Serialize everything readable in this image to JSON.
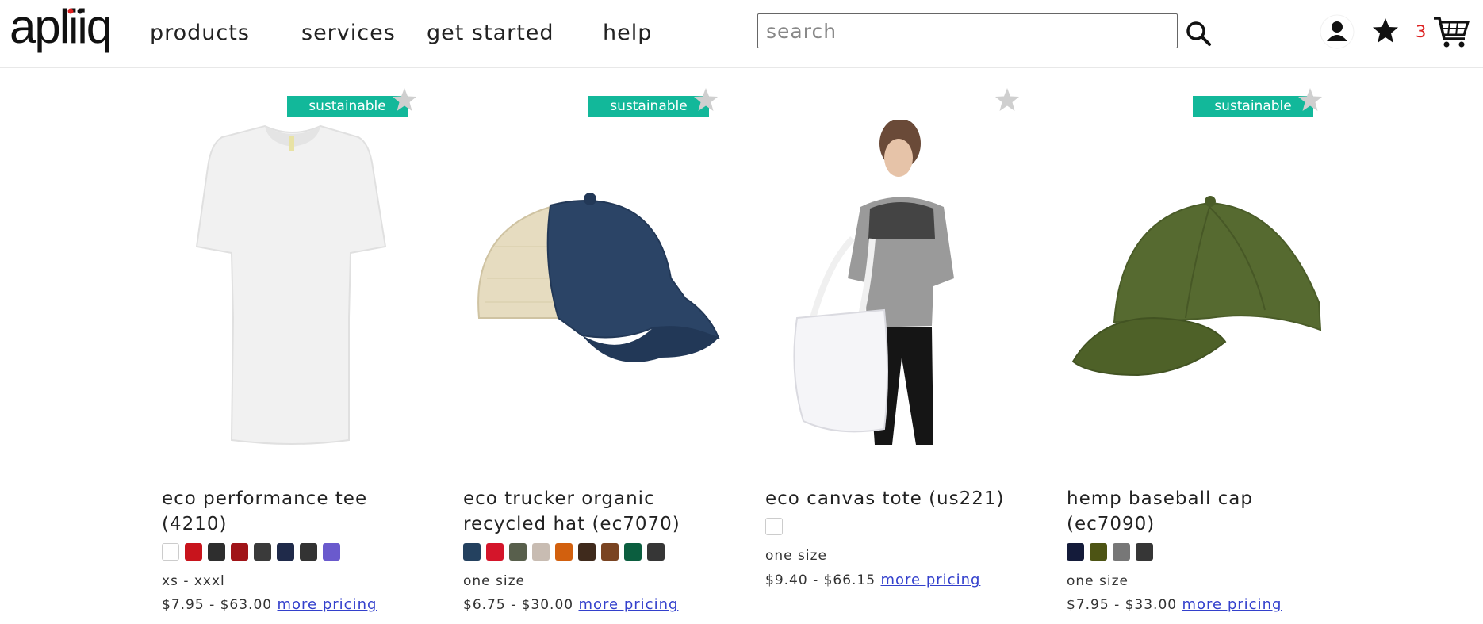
{
  "header": {
    "logo_text": "apliiq",
    "nav": [
      {
        "label": "products"
      },
      {
        "label": "services"
      },
      {
        "label": "get started"
      },
      {
        "label": "help"
      }
    ],
    "search": {
      "placeholder": "search",
      "value": ""
    },
    "icons": [
      "search-icon",
      "account-icon",
      "favorites-star-icon",
      "cart-icon"
    ],
    "favorites_count": "3"
  },
  "colors": {
    "accent_badge": "#12b89a",
    "link": "#3340cc",
    "count": "#dd2222"
  },
  "products": [
    {
      "badge": "sustainable",
      "title": "eco performance tee (4210)",
      "swatches": [
        "#ffffff",
        "#c8141c",
        "#2e2e2e",
        "#a01418",
        "#3a3a3a",
        "#1f2a4a",
        "#333333",
        "#6a5acd"
      ],
      "sizes": "xs - xxxl",
      "price": "$7.95 - $63.00",
      "more_pricing": "more pricing"
    },
    {
      "badge": "sustainable",
      "title": "eco trucker organic recycled hat (ec7070)",
      "swatches": [
        "#24415f",
        "#d4152a",
        "#585f4c",
        "#c8bcb2",
        "#d2600e",
        "#3f2a1c",
        "#7a4422",
        "#0b5e3f",
        "#363636"
      ],
      "sizes": "one size",
      "price": "$6.75 - $30.00",
      "more_pricing": "more pricing"
    },
    {
      "badge": "",
      "title": "eco canvas tote (us221)",
      "swatches": [
        "#ffffff"
      ],
      "sizes": "one size",
      "price": "$9.40 - $66.15",
      "more_pricing": "more pricing"
    },
    {
      "badge": "sustainable",
      "title": "hemp baseball cap (ec7090)",
      "swatches": [
        "#141b3a",
        "#4d5414",
        "#777777",
        "#363636"
      ],
      "sizes": "one size",
      "price": "$7.95 - $33.00",
      "more_pricing": "more pricing"
    }
  ]
}
